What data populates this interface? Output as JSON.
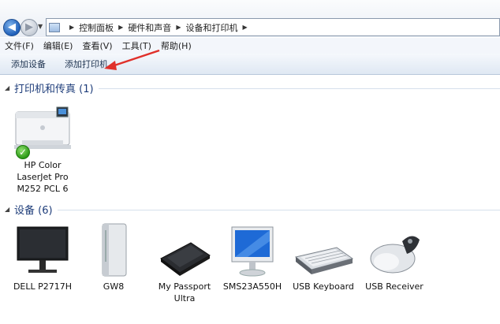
{
  "address_bar": {
    "breadcrumbs": [
      "控制面板",
      "硬件和声音",
      "设备和打印机"
    ]
  },
  "menu": [
    "文件(F)",
    "编辑(E)",
    "查看(V)",
    "工具(T)",
    "帮助(H)"
  ],
  "commands": [
    "添加设备",
    "添加打印机"
  ],
  "groups": {
    "printers": {
      "title": "打印机和传真 (1)"
    },
    "devices": {
      "title": "设备 (6)"
    }
  },
  "printer": {
    "name": "HP Color LaserJet Pro M252 PCL 6",
    "lines": [
      "HP Color",
      "LaserJet Pro",
      "M252 PCL 6"
    ]
  },
  "devices": [
    {
      "name": "DELL P2717H",
      "lines": [
        "DELL P2717H"
      ]
    },
    {
      "name": "GW8",
      "lines": [
        "GW8"
      ]
    },
    {
      "name": "My Passport Ultra",
      "lines": [
        "My Passport",
        "Ultra"
      ]
    },
    {
      "name": "SMS23A550H",
      "lines": [
        "SMS23A550H"
      ]
    },
    {
      "name": "USB Keyboard",
      "lines": [
        "USB Keyboard"
      ]
    },
    {
      "name": "USB Receiver",
      "lines": [
        "USB Receiver"
      ]
    }
  ],
  "colors": {
    "annotation_arrow": "#e0302a",
    "group_title": "#1e3d7a"
  }
}
